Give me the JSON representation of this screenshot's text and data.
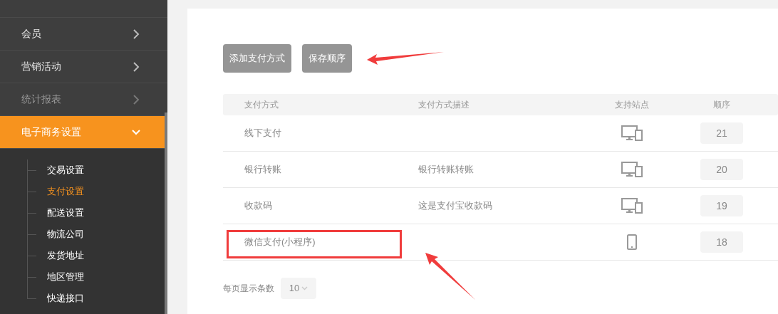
{
  "sidebar": {
    "items": [
      {
        "label": "会员",
        "disabled": false,
        "expanded": false
      },
      {
        "label": "营销活动",
        "disabled": false,
        "expanded": false
      },
      {
        "label": "统计报表",
        "disabled": true,
        "expanded": false
      },
      {
        "label": "电子商务设置",
        "disabled": false,
        "expanded": true,
        "children": [
          {
            "label": "交易设置",
            "selected": false
          },
          {
            "label": "支付设置",
            "selected": true
          },
          {
            "label": "配送设置",
            "selected": false
          },
          {
            "label": "物流公司",
            "selected": false
          },
          {
            "label": "发货地址",
            "selected": false
          },
          {
            "label": "地区管理",
            "selected": false
          },
          {
            "label": "快递接口",
            "selected": false
          }
        ]
      }
    ]
  },
  "buttons": [
    {
      "label": "添加支付方式",
      "marked": false
    },
    {
      "label": "保存顺序",
      "marked": true
    }
  ],
  "table": {
    "columns": [
      "支付方式",
      "支付方式描述",
      "支持站点",
      "顺序"
    ],
    "rows": [
      {
        "name": "线下支付",
        "kind": "all",
        "order": "21",
        "marked": false
      },
      {
        "name": "银行转账",
        "description": "银行转账转账",
        "kind": "all",
        "order": "20",
        "marked": false
      },
      {
        "name": "收款码",
        "description": "这是支付宝收款码",
        "kind": "all",
        "order": "19",
        "marked": false
      },
      {
        "name": "微信支付(小程序)",
        "kind": "mobile",
        "order": "18",
        "marked": true
      }
    ]
  },
  "pagination": {
    "label": "每页显示条数",
    "page_size": "10"
  }
}
